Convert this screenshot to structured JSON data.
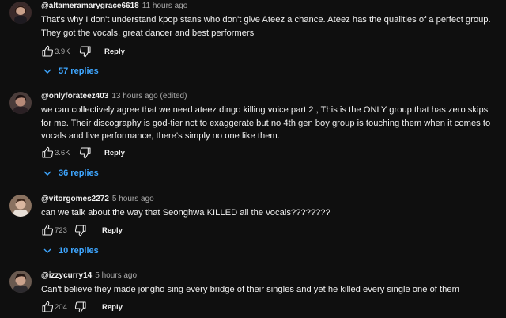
{
  "comments": [
    {
      "author": "@altameramarygrace6618",
      "time": "11 hours ago",
      "text": "That's why I don't understand kpop stans who don't give Ateez a chance. Ateez has the qualities of a perfect group. They got the vocals, great dancer and best performers",
      "likes": "3.9K",
      "reply_label": "Reply",
      "replies_label": "57 replies",
      "avatar_color": "#3a2a2a"
    },
    {
      "author": "@onlyforateez403",
      "time": "13 hours ago (edited)",
      "text": "we can collectively agree that we need ateez dingo killing voice part 2 , This is the ONLY group that has zero skips for me. Their discography is god-tier not to exaggerate but no 4th gen boy group is touching them when it comes to vocals and live performance, there's simply no one like them.",
      "likes": "3.6K",
      "reply_label": "Reply",
      "replies_label": "36 replies",
      "avatar_color": "#4a3c3a"
    },
    {
      "author": "@vitorgomes2272",
      "time": "5 hours ago",
      "text": "can we talk about the way that Seonghwa KILLED all the vocals????????",
      "likes": "723",
      "reply_label": "Reply",
      "replies_label": "10 replies",
      "avatar_color": "#8a7260"
    },
    {
      "author": "@izzycurry14",
      "time": "5 hours ago",
      "text": "Can't believe they made jongho sing every bridge of their singles and yet he killed every single one of them",
      "likes": "204",
      "reply_label": "Reply",
      "avatar_color": "#6a5a50"
    }
  ],
  "icons": {
    "like": "thumbs-up-icon",
    "dislike": "thumbs-down-icon",
    "expand": "chevron-down-icon"
  },
  "colors": {
    "background": "#0f0f0f",
    "text": "#f1f1f1",
    "secondary_text": "#aaaaaa",
    "link": "#3ea6ff"
  }
}
